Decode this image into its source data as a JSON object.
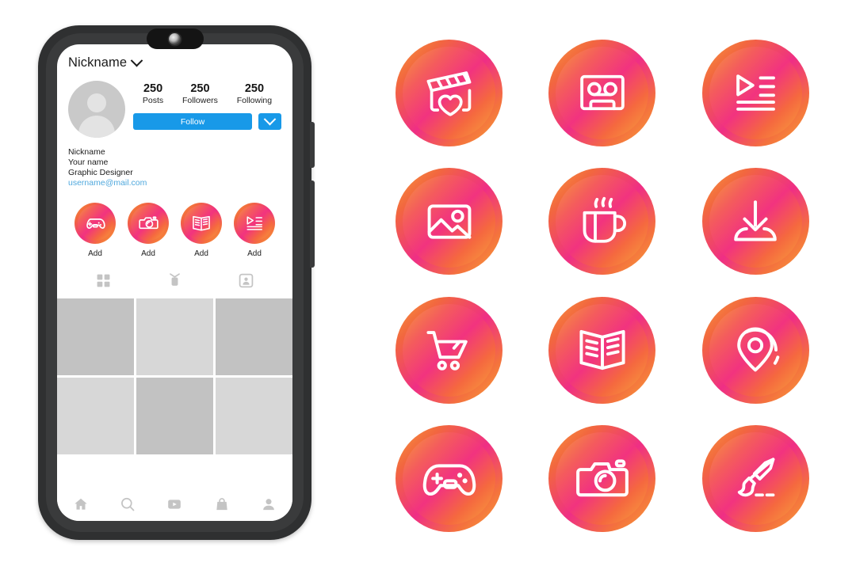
{
  "phone": {
    "header": {
      "nickname": "Nickname",
      "chevron_icon": "chevron-down-icon"
    },
    "avatar_icon": "avatar-placeholder-icon",
    "stats": [
      {
        "value": "250",
        "label": "Posts"
      },
      {
        "value": "250",
        "label": "Followers"
      },
      {
        "value": "250",
        "label": "Following"
      }
    ],
    "actions": {
      "follow_label": "Follow",
      "dropdown_icon": "chevron-down-icon",
      "accent_color": "#1899e8"
    },
    "bio": {
      "line1": "Nickname",
      "line2": "Your name",
      "line3": "Graphic Designer",
      "email": "username@mail.com",
      "email_color": "#4fa8dd"
    },
    "highlights": [
      {
        "icon": "gamepad-icon",
        "label": "Add"
      },
      {
        "icon": "camera-icon",
        "label": "Add"
      },
      {
        "icon": "open-book-icon",
        "label": "Add"
      },
      {
        "icon": "playlist-icon",
        "label": "Add"
      }
    ],
    "tabs": [
      {
        "icon": "grid-tab-icon"
      },
      {
        "icon": "reels-tab-icon"
      },
      {
        "icon": "tagged-tab-icon"
      }
    ],
    "photo_grid": [
      {
        "shade": "#c2c2c2"
      },
      {
        "shade": "#d7d7d7"
      },
      {
        "shade": "#c2c2c2"
      },
      {
        "shade": "#d7d7d7"
      },
      {
        "shade": "#c2c2c2"
      },
      {
        "shade": "#d7d7d7"
      }
    ],
    "bottom_nav": [
      {
        "icon": "home-icon"
      },
      {
        "icon": "search-icon"
      },
      {
        "icon": "reels-play-icon"
      },
      {
        "icon": "shop-bag-icon"
      },
      {
        "icon": "profile-icon"
      }
    ]
  },
  "icon_grid": {
    "gradient_start": "#f89c3a",
    "gradient_mid": "#f2337f",
    "gradient_end": "#f9a63b",
    "items": [
      {
        "icon": "clapperboard-heart-icon"
      },
      {
        "icon": "cassette-tape-icon"
      },
      {
        "icon": "playlist-icon"
      },
      {
        "icon": "photo-image-icon"
      },
      {
        "icon": "coffee-cup-icon"
      },
      {
        "icon": "download-icon"
      },
      {
        "icon": "shopping-cart-icon"
      },
      {
        "icon": "open-book-icon"
      },
      {
        "icon": "location-pin-icon"
      },
      {
        "icon": "gamepad-icon"
      },
      {
        "icon": "camera-icon"
      },
      {
        "icon": "paint-brush-icon"
      }
    ]
  }
}
